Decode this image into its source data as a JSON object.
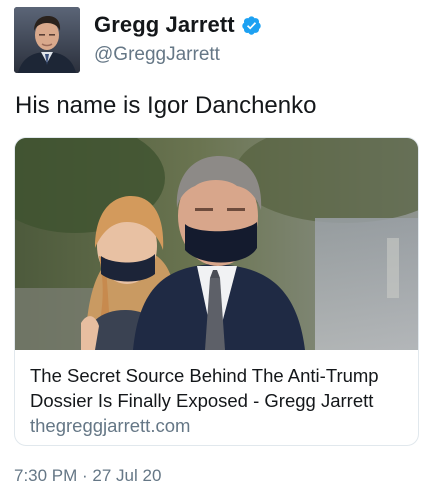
{
  "author": {
    "display_name": "Gregg Jarrett",
    "handle": "@GreggJarrett",
    "verified": true,
    "avatar_icon": "profile-photo",
    "verified_icon": "verified-badge-icon",
    "verified_color": "#1da1f2"
  },
  "tweet": {
    "text": "His name is Igor Danchenko",
    "timestamp": "7:30 PM · 27 Jul 20"
  },
  "card": {
    "title": "The Secret Source Behind The Anti-Trump Dossier Is Finally Exposed - Gregg Jarrett",
    "domain": "thegreggjarrett.com"
  }
}
